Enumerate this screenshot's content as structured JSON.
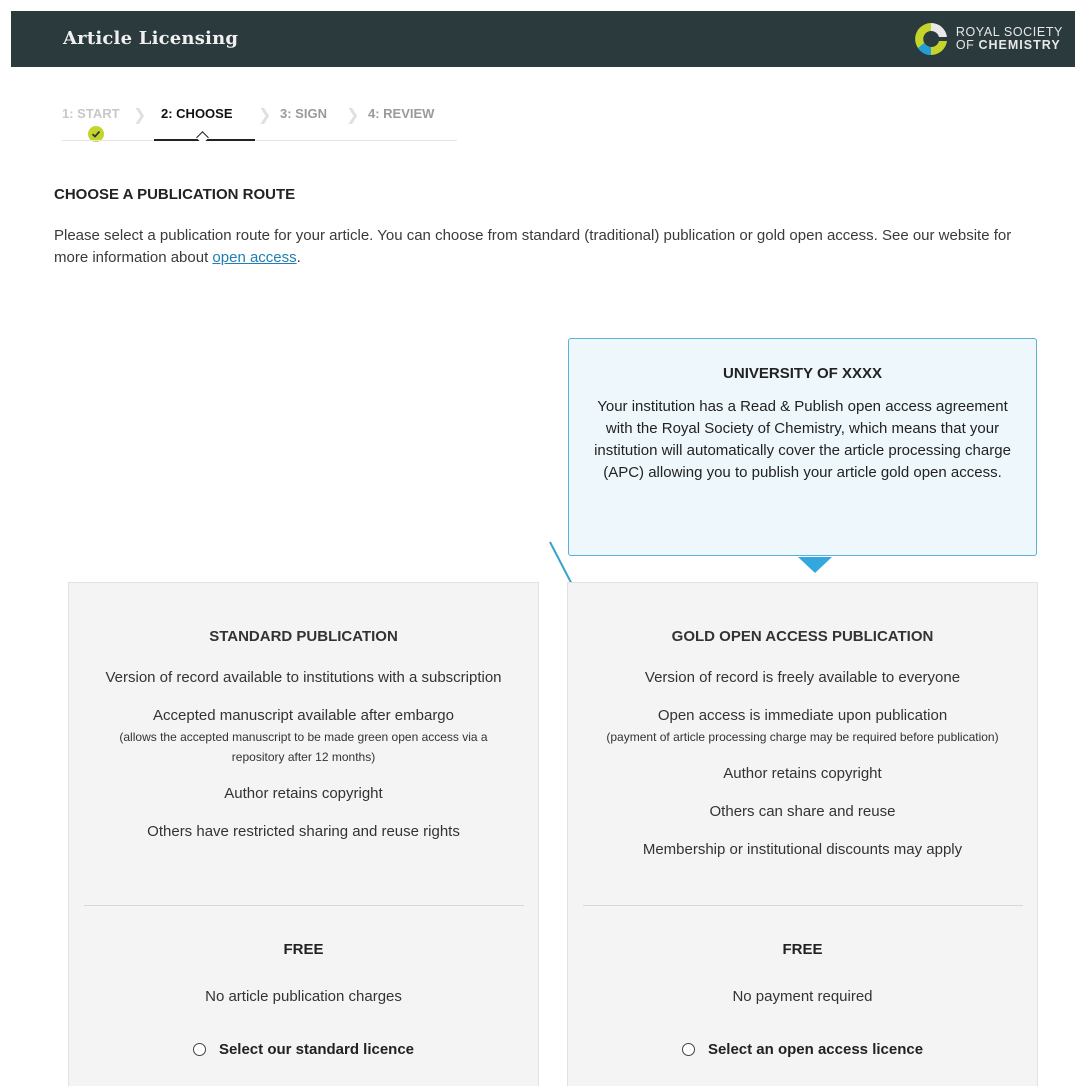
{
  "header": {
    "title": "Article Licensing",
    "logo": {
      "line1": "ROYAL SOCIETY",
      "line2_prefix": "OF ",
      "line2_bold": "CHEMISTRY"
    }
  },
  "steps": [
    {
      "label": "1: START",
      "state": "done"
    },
    {
      "label": "2: CHOOSE",
      "state": "active"
    },
    {
      "label": "3: SIGN",
      "state": "todo"
    },
    {
      "label": "4: REVIEW",
      "state": "todo"
    }
  ],
  "main": {
    "heading": "CHOOSE A PUBLICATION ROUTE",
    "intro_before": "Please select a publication route for your article. You can choose from standard (traditional) publication or gold open access. See our website for more information about ",
    "intro_link": "open access",
    "intro_after": "."
  },
  "institution": {
    "title": "UNIVERSITY OF XXXX",
    "body": "Your institution has a Read & Publish open access agreement with the Royal Society of Chemistry, which means that your institution will automatically cover the article processing charge (APC) allowing you to publish your article gold open access."
  },
  "standard": {
    "title": "STANDARD PUBLICATION",
    "features": [
      {
        "text": "Version of record available to institutions with a subscription"
      },
      {
        "text": "Accepted manuscript available after embargo",
        "sub": "(allows the accepted manuscript to be made green open access via a repository after 12 months)"
      },
      {
        "text": "Author retains copyright"
      },
      {
        "text": "Others have restricted sharing and reuse rights"
      }
    ],
    "price": "FREE",
    "price_note": "No article publication charges",
    "select_label": "Select our standard licence"
  },
  "gold": {
    "title": "GOLD OPEN ACCESS PUBLICATION",
    "features": [
      {
        "text": "Version of record is freely available to everyone"
      },
      {
        "text": "Open access is immediate upon publication",
        "sub": "(payment of article processing charge may be required before publication)"
      },
      {
        "text": "Author retains copyright"
      },
      {
        "text": "Others can share and reuse"
      },
      {
        "text": "Membership or institutional discounts may apply"
      }
    ],
    "price": "FREE",
    "price_note": "No payment required",
    "select_label": "Select an open access licence"
  },
  "colors": {
    "header_bg": "#2b3a3d",
    "step_done": "#c4d42b",
    "tooltip_border": "#5ab0d8",
    "accent_arrow": "#33a8de",
    "link": "#1f7fb4"
  }
}
